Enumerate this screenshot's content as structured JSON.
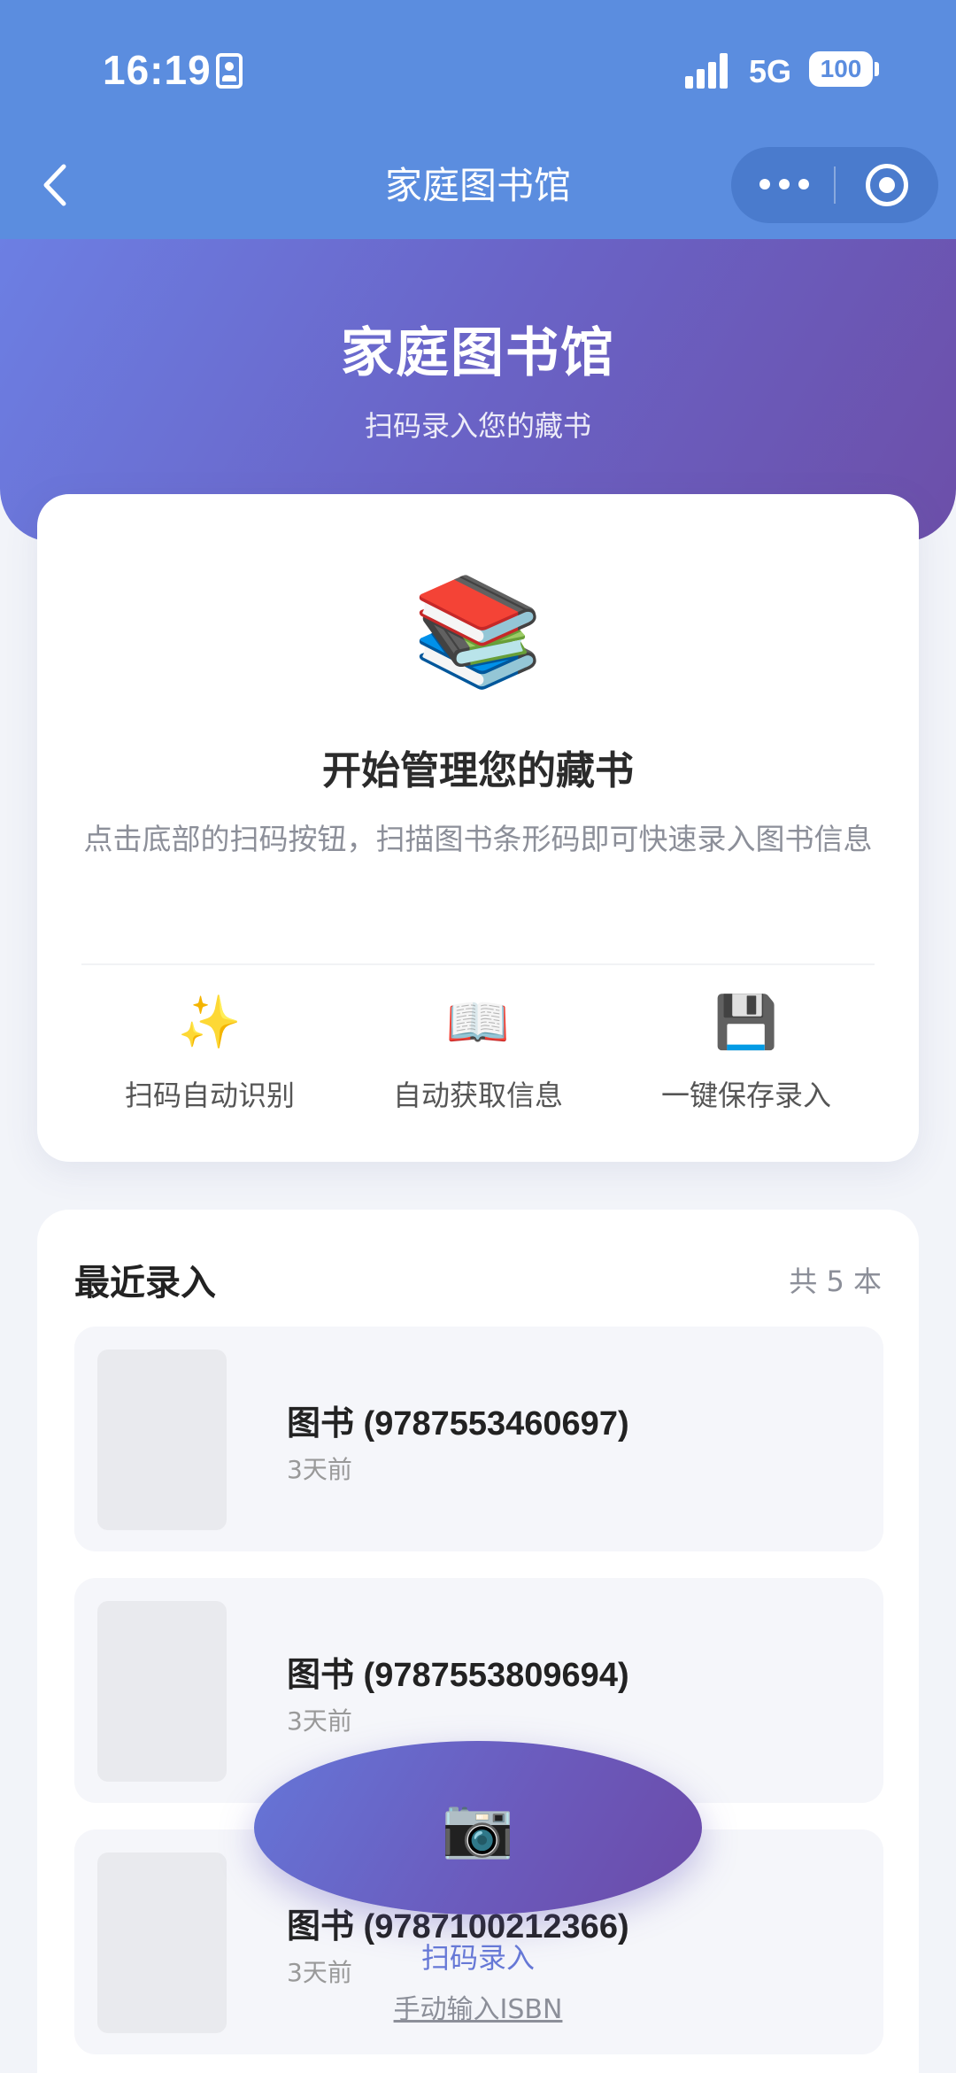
{
  "status_bar": {
    "time": "16:19",
    "network": "5G",
    "battery": "100"
  },
  "nav": {
    "title": "家庭图书馆"
  },
  "hero": {
    "title": "家庭图书馆",
    "subtitle": "扫码录入您的藏书"
  },
  "intro": {
    "icon": "📚",
    "title": "开始管理您的藏书",
    "description": "点击底部的扫码按钮，扫描图书条形码即可快速录入图书信息",
    "features": [
      {
        "icon": "✨",
        "label": "扫码自动识别"
      },
      {
        "icon": "📖",
        "label": "自动获取信息"
      },
      {
        "icon": "💾",
        "label": "一键保存录入"
      }
    ]
  },
  "recent": {
    "title": "最近录入",
    "count": "共 5 本",
    "items": [
      {
        "name": "图书 (9787553460697)",
        "time": "3天前"
      },
      {
        "name": "图书 (9787553809694)",
        "time": "3天前"
      },
      {
        "name": "图书 (9787100212366)",
        "time": "3天前"
      }
    ]
  },
  "scan": {
    "icon": "📷",
    "label": "扫码录入",
    "manual_link": "手动输入ISBN"
  },
  "colors": {
    "nav_bg": "#5b8ddf",
    "hero_gradient_start": "#6c7fe3",
    "hero_gradient_end": "#6c4fa9",
    "accent_text": "#6678d6",
    "page_bg": "#f2f4f9"
  }
}
